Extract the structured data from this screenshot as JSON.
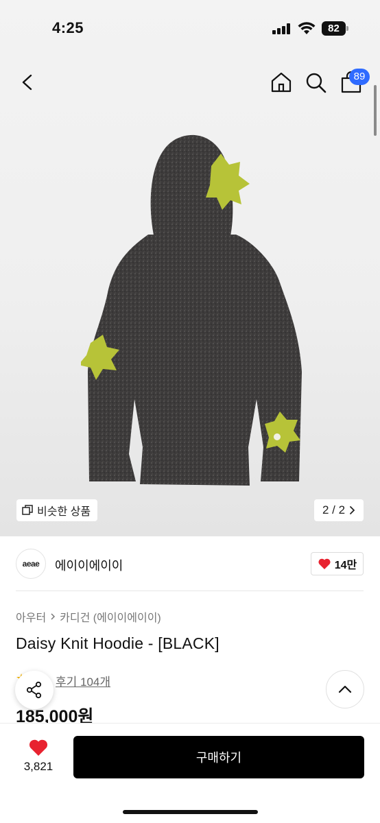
{
  "status_bar": {
    "time": "4:25",
    "battery": "82"
  },
  "nav": {
    "cart_count": "89"
  },
  "gallery": {
    "similar_label": "비슷한 상품",
    "page_indicator": "2 / 2"
  },
  "brand": {
    "logo_text": "aeae",
    "name": "에이이에이이",
    "likes": "14만"
  },
  "breadcrumb": {
    "category": "아우터",
    "subcategory": "카디건 (에이이에이이)"
  },
  "product": {
    "title": "Daisy Knit Hoodie - [BLACK]",
    "review_link": "후기 104개",
    "price": "185,000원"
  },
  "bottom_bar": {
    "wish_count": "3,821",
    "buy_label": "구매하기"
  },
  "colors": {
    "accent": "#2f6bff",
    "heart": "#e8222f",
    "buy_button": "#000000"
  }
}
